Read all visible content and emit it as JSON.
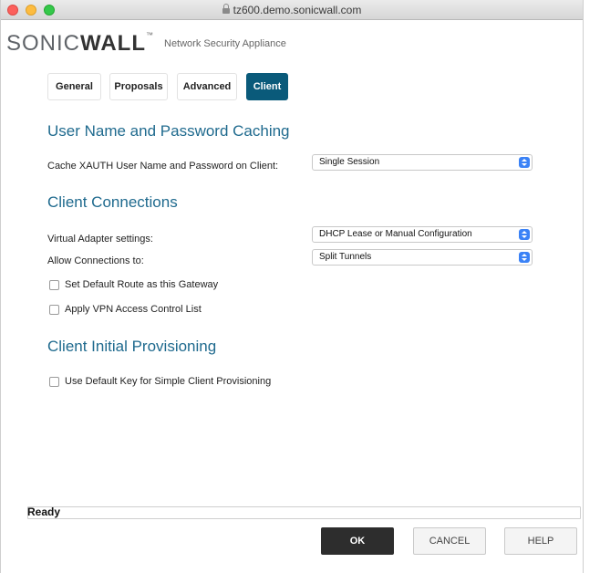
{
  "window": {
    "title": "tz600.demo.sonicwall.com"
  },
  "header": {
    "logo_light": "SONIC",
    "logo_bold": "WALL",
    "logo_tm": "™",
    "product": "Network Security Appliance"
  },
  "tabs": [
    {
      "label": "General",
      "active": false
    },
    {
      "label": "Proposals",
      "active": false
    },
    {
      "label": "Advanced",
      "active": false
    },
    {
      "label": "Client",
      "active": true
    }
  ],
  "sections": {
    "caching": {
      "title": "User Name and Password Caching",
      "cache_label": "Cache XAUTH User Name and Password on Client:",
      "cache_value": "Single Session"
    },
    "connections": {
      "title": "Client Connections",
      "adapter_label": "Virtual Adapter settings:",
      "adapter_value": "DHCP Lease or Manual Configuration",
      "allow_label": "Allow Connections to:",
      "allow_value": "Split Tunnels",
      "default_route_label": "Set Default Route as this Gateway",
      "default_route_checked": false,
      "acl_label": "Apply VPN Access Control List",
      "acl_checked": false
    },
    "provisioning": {
      "title": "Client Initial Provisioning",
      "default_key_label": "Use Default Key for Simple Client Provisioning",
      "default_key_checked": false
    }
  },
  "status": {
    "text": "Ready"
  },
  "buttons": {
    "ok": "OK",
    "cancel": "CANCEL",
    "help": "HELP"
  },
  "colors": {
    "accent": "#1f6a8e",
    "active_tab": "#0a5a7a",
    "ok_button": "#2d2d2d"
  },
  "icons": {
    "lock": "lock-icon",
    "select_arrow": "updown-chevron-icon"
  }
}
